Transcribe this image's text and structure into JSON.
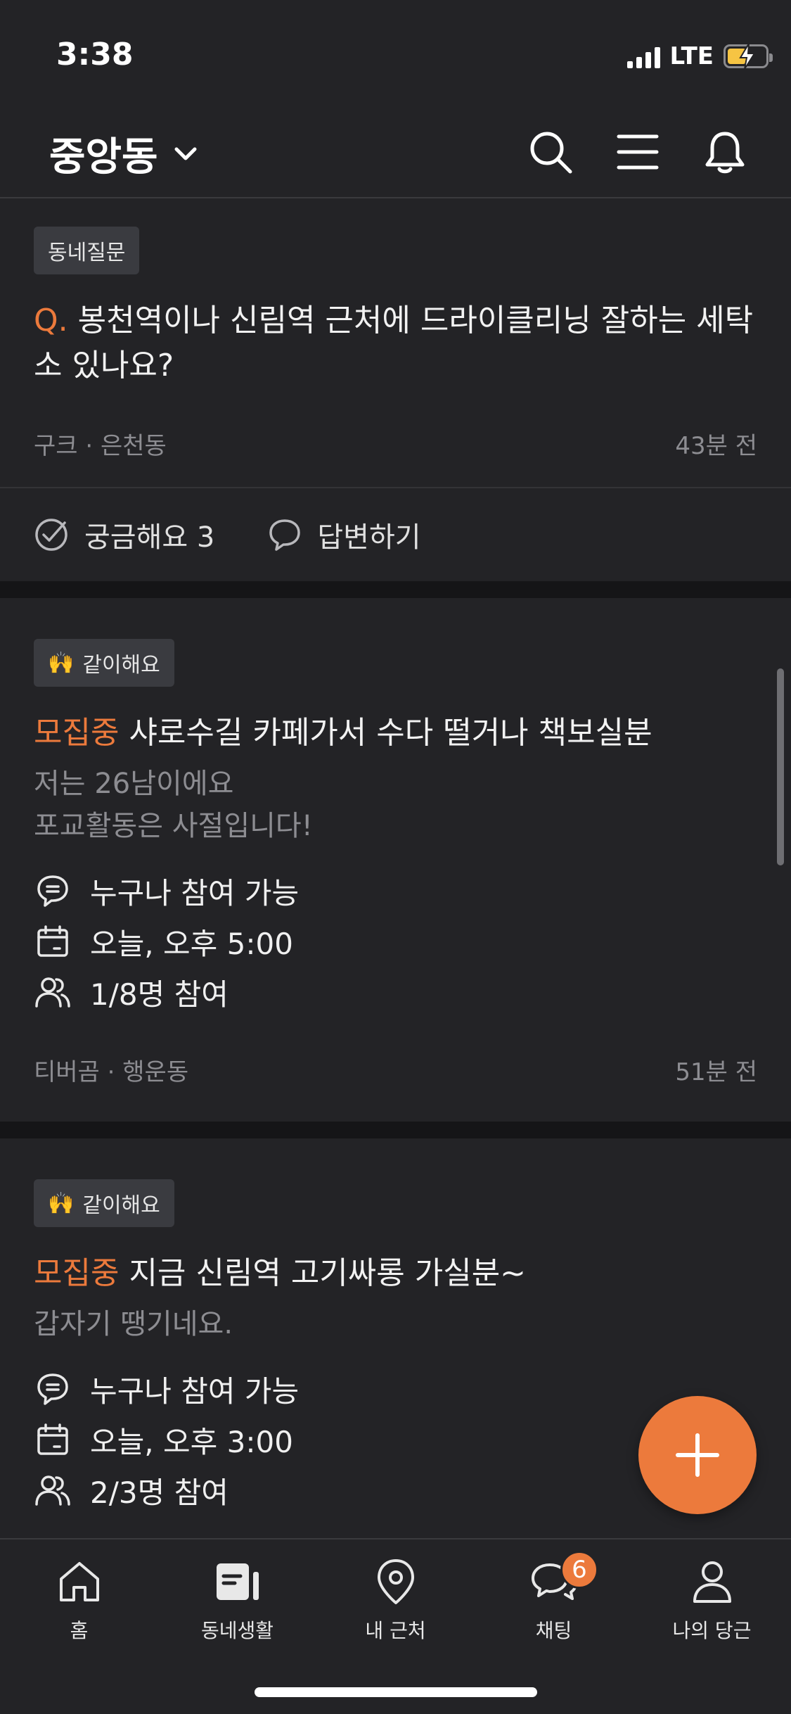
{
  "status_bar": {
    "time": "3:38",
    "network": "LTE"
  },
  "header": {
    "location": "중앙동"
  },
  "feed": {
    "question_card": {
      "tag": "동네질문",
      "q_prefix": "Q.",
      "title": "봉천역이나 신림역 근처에 드라이클리닝 잘하는 세탁소 있나요?",
      "author": "구크 · 은천동",
      "time_ago": "43분 전",
      "curious_label": "궁금해요 3",
      "answer_label": "답변하기"
    },
    "meetup_cards": [
      {
        "tag_emoji": "🙌",
        "tag": "같이해요",
        "status": "모집중",
        "title": "샤로수길 카페가서 수다 떨거나 책보실분",
        "desc_lines": [
          "저는 26남이에요",
          "포교활동은 사절입니다!"
        ],
        "participation": "누구나 참여 가능",
        "datetime": "오늘, 오후 5:00",
        "members": "1/8명 참여",
        "author": "티버곰 · 행운동",
        "time_ago": "51분 전"
      },
      {
        "tag_emoji": "🙌",
        "tag": "같이해요",
        "status": "모집중",
        "title": "지금 신림역 고기싸롱 가실분~",
        "desc_lines": [
          "갑자기 땡기네요."
        ],
        "participation": "누구나 참여 가능",
        "datetime": "오늘, 오후 3:00",
        "members": "2/3명 참여"
      }
    ]
  },
  "tab_bar": {
    "tabs": [
      {
        "label": "홈",
        "icon": "home-icon"
      },
      {
        "label": "동네생활",
        "icon": "neighborhood-icon"
      },
      {
        "label": "내 근처",
        "icon": "location-pin-icon"
      },
      {
        "label": "채팅",
        "icon": "chat-icon",
        "badge": "6"
      },
      {
        "label": "나의 당근",
        "icon": "profile-icon"
      }
    ]
  },
  "colors": {
    "accent": "#ec7a3c",
    "background": "#232326",
    "separator": "#151517"
  }
}
